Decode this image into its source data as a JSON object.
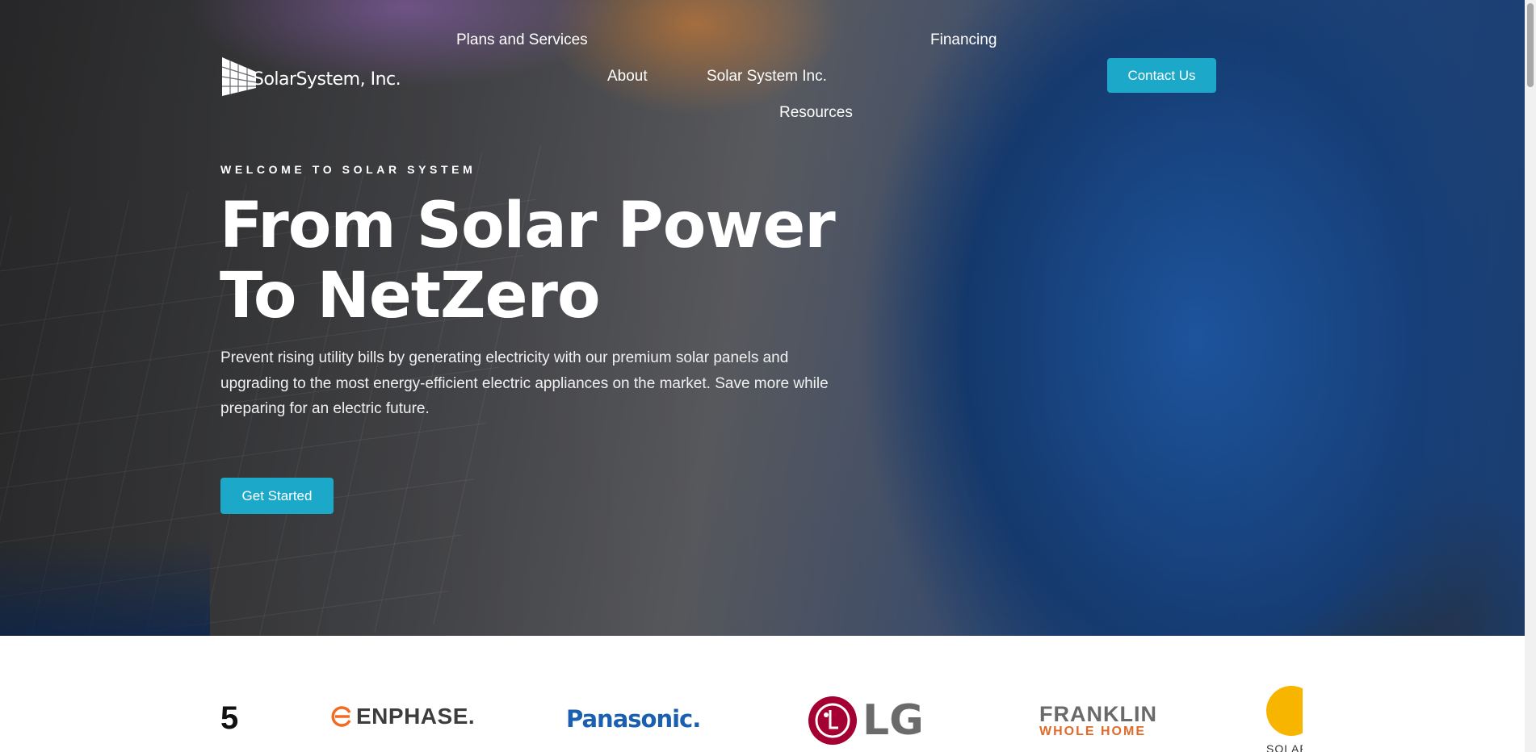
{
  "brand": {
    "name": "SolarSystem, Inc."
  },
  "nav": {
    "items": [
      {
        "label": "Plans and Services"
      },
      {
        "label": "Financing"
      },
      {
        "label": "About"
      },
      {
        "label": "Solar System Inc."
      },
      {
        "label": "Resources"
      }
    ],
    "contact_label": "Contact Us"
  },
  "hero": {
    "eyebrow": "WELCOME TO SOLAR SYSTEM",
    "headline_line1": "From Solar Power",
    "headline_line2": "To NetZero",
    "lead": "Prevent rising utility bills by generating electricity with our premium solar panels and upgrading to the most energy-efficient electric appliances on the market. Save more while preparing for an electric future.",
    "cta_label": "Get Started"
  },
  "partners": {
    "items": [
      {
        "label": "ENPHASE."
      },
      {
        "label": "Panasonic."
      },
      {
        "label": "LG"
      },
      {
        "label": "FRANKLIN",
        "sub": "WHOLE HOME"
      },
      {
        "label": "SOLAR"
      }
    ]
  },
  "colors": {
    "accent": "#1ba8c9",
    "text_on_hero": "#ffffff"
  }
}
